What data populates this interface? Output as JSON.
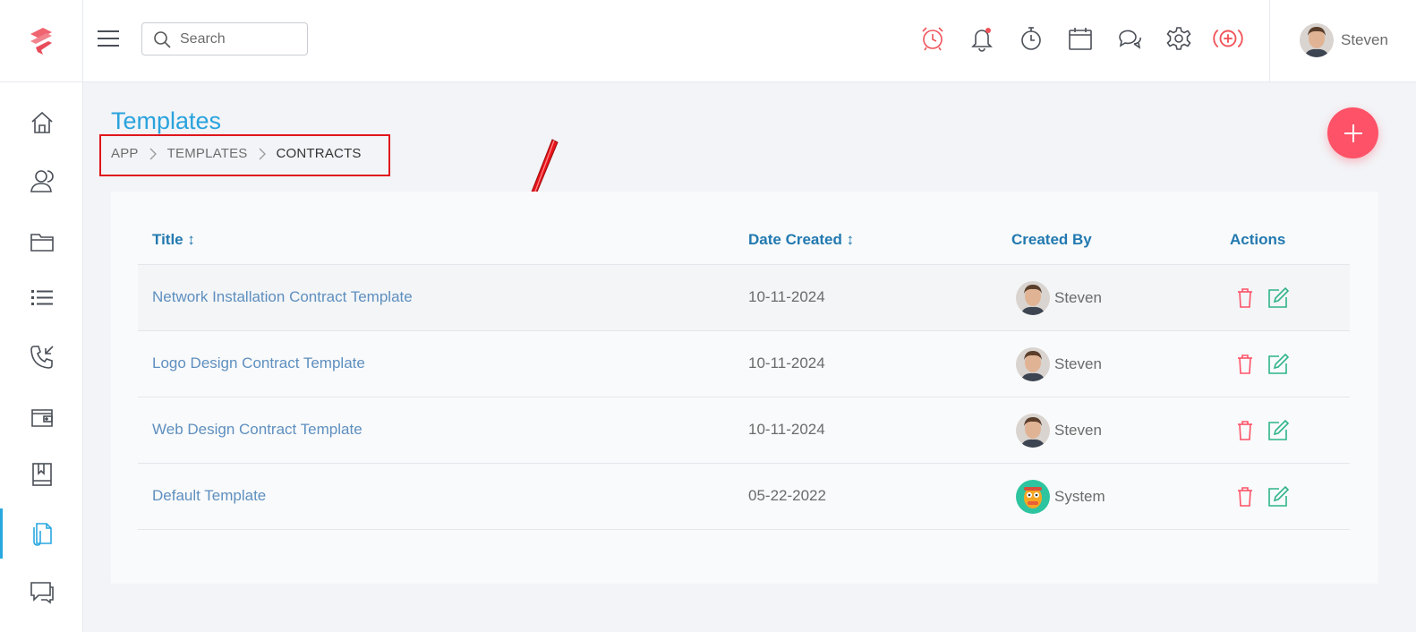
{
  "header": {
    "search": {
      "placeholder": "Search"
    },
    "icons": [
      {
        "name": "alarm-clock-icon",
        "color": "#f0545a"
      },
      {
        "name": "bell-notification-icon",
        "color": "#4a4f57"
      },
      {
        "name": "stopwatch-icon",
        "color": "#4a4f57"
      },
      {
        "name": "calendar-icon",
        "color": "#4a4f57"
      },
      {
        "name": "chat-bubbles-icon",
        "color": "#4a4f57"
      },
      {
        "name": "gear-icon",
        "color": "#4a4f57"
      },
      {
        "name": "add-circle-icon",
        "color": "#f0545a"
      }
    ],
    "user": {
      "name": "Steven"
    }
  },
  "sidebar": {
    "items": [
      {
        "name": "home-icon"
      },
      {
        "name": "contacts-icon"
      },
      {
        "name": "folder-icon"
      },
      {
        "name": "list-icon"
      },
      {
        "name": "phone-call-icon"
      },
      {
        "name": "wallet-icon"
      },
      {
        "name": "bookmark-book-icon"
      },
      {
        "name": "templates-icon",
        "active": true
      },
      {
        "name": "messages-icon"
      }
    ]
  },
  "page": {
    "title": "Templates",
    "breadcrumb": [
      "APP",
      "TEMPLATES",
      "CONTRACTS"
    ]
  },
  "table": {
    "columns": {
      "title": "Title ↕",
      "date_created": "Date Created ↕",
      "created_by": "Created By",
      "actions": "Actions"
    },
    "rows": [
      {
        "title": "Network Installation Contract Template",
        "date": "10-11-2024",
        "created_by": "Steven",
        "avatar": "steven"
      },
      {
        "title": "Logo Design Contract Template",
        "date": "10-11-2024",
        "created_by": "Steven",
        "avatar": "steven"
      },
      {
        "title": "Web Design Contract Template",
        "date": "10-11-2024",
        "created_by": "Steven",
        "avatar": "steven"
      },
      {
        "title": "Default Template",
        "date": "05-22-2022",
        "created_by": "System",
        "avatar": "system"
      }
    ]
  },
  "colors": {
    "accent": "#2aa3dd",
    "danger": "#fd5267",
    "edit": "#2fb487",
    "highlight_box": "#e0161d"
  }
}
